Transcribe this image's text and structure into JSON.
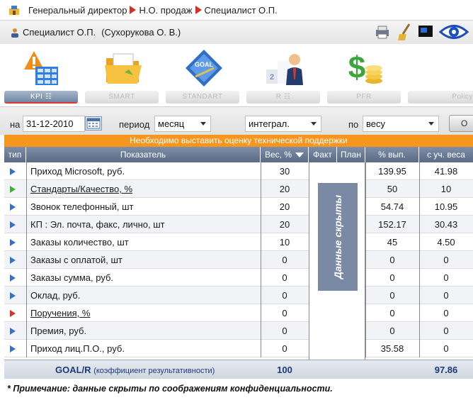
{
  "breadcrumb": [
    "Генеральный директор",
    "Н.О. продаж",
    "Специалист О.П."
  ],
  "user": {
    "role": "Специалист О.П.",
    "name": "(Сухорукова О. В.)"
  },
  "modules": [
    {
      "label": "KPI ☷",
      "icon": "alert-grid-icon"
    },
    {
      "label": "SMART",
      "icon": "folder-icon"
    },
    {
      "label": "STANDART",
      "icon": "goal-icon"
    },
    {
      "label": "R ☷",
      "icon": "podium-person-icon"
    },
    {
      "label": "PFR",
      "icon": "money-icon"
    },
    {
      "label": "Policy",
      "icon": "policy-icon"
    }
  ],
  "filters": {
    "date_label": "на",
    "date_value": "31-12-2010",
    "period_label": "период",
    "period_value": "месяц",
    "mode_value": "интеграл.",
    "by_label": "по",
    "by_value": "весу",
    "ok_label": "О"
  },
  "warning": "Необходимо выставить оценку технической поддержки",
  "table": {
    "headers": {
      "type": "тип",
      "name": "Показатель",
      "weight": "Вес, %",
      "fact": "Факт",
      "plan": "План",
      "pct": "% вып.",
      "weighted": "с уч. веса"
    },
    "rows": [
      {
        "type": "blue",
        "name": "Приход Microsoft, руб.",
        "link": false,
        "weight": "30",
        "pct": "139.95",
        "weighted": "41.98"
      },
      {
        "type": "green",
        "name": "Стандарты/Качество, %",
        "link": true,
        "weight": "20",
        "pct": "50",
        "weighted": "10"
      },
      {
        "type": "blue",
        "name": "Звонок телефонный, шт",
        "link": false,
        "weight": "20",
        "pct": "54.74",
        "weighted": "10.95"
      },
      {
        "type": "blue",
        "name": "КП : Эл. почта, факс, лично, шт",
        "link": false,
        "weight": "20",
        "pct": "152.17",
        "weighted": "30.43"
      },
      {
        "type": "blue",
        "name": "Заказы количество, шт",
        "link": false,
        "weight": "10",
        "pct": "45",
        "weighted": "4.50"
      },
      {
        "type": "blue",
        "name": "Заказы с оплатой, шт",
        "link": false,
        "weight": "0",
        "pct": "0",
        "weighted": "0"
      },
      {
        "type": "blue",
        "name": "Заказы сумма, руб.",
        "link": false,
        "weight": "0",
        "pct": "0",
        "weighted": "0"
      },
      {
        "type": "blue",
        "name": "Оклад, руб.",
        "link": false,
        "weight": "0",
        "pct": "0",
        "weighted": "0"
      },
      {
        "type": "red",
        "name": "Поручения, %",
        "link": true,
        "weight": "0",
        "pct": "0",
        "weighted": "0"
      },
      {
        "type": "blue",
        "name": "Премия, руб.",
        "link": false,
        "weight": "0",
        "pct": "0",
        "weighted": "0"
      },
      {
        "type": "blue",
        "name": "Приход лиц.П.О., руб.",
        "link": false,
        "weight": "0",
        "pct": "35.58",
        "weighted": "0"
      }
    ],
    "hidden_label": "Данные скрыты",
    "footer": {
      "goal": "GOAL/R",
      "goal_note": "(коэффициент результативности)",
      "weight_total": "100",
      "weighted_total": "97.86"
    }
  },
  "note": "* Примечание: данные скрыты по соображениям конфиденциальности.",
  "colors": {
    "accent": "#f8951d",
    "header": "#6b7b96",
    "blue_marker": "#3a6fc8",
    "green_marker": "#3bb33b",
    "red_marker": "#d9302a"
  }
}
